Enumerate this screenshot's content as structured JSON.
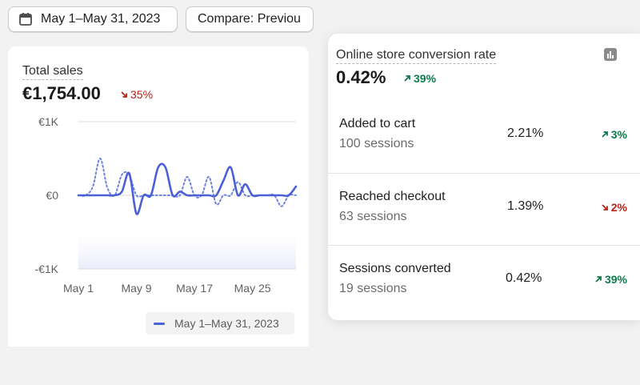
{
  "toolbar": {
    "date_range_label": "May 1–May 31, 2023",
    "compare_label": "Compare: Previou"
  },
  "total_sales": {
    "title": "Total sales",
    "value": "€1,754.00",
    "delta": "35%",
    "delta_direction": "down"
  },
  "chart_data": {
    "type": "line",
    "ylabel": "",
    "xlabel": "",
    "ylim": [
      -1000,
      1000
    ],
    "y_tick_labels": [
      "€1K",
      "€0",
      "-€1K"
    ],
    "y_ticks": [
      1000,
      0,
      -1000
    ],
    "x_range": [
      1,
      31
    ],
    "x_tick_labels": [
      "May 1",
      "May 9",
      "May 17",
      "May 25"
    ],
    "x_ticks": [
      1,
      9,
      17,
      25
    ],
    "grid": true,
    "legend": "bottom",
    "series": [
      {
        "name": "May 1–May 31, 2023",
        "style": "solid",
        "color": "#4b5fd6",
        "x": [
          1,
          2,
          3,
          4,
          5,
          6,
          7,
          8,
          9,
          10,
          11,
          12,
          13,
          14,
          15,
          16,
          17,
          18,
          19,
          20,
          21,
          22,
          23,
          24,
          25,
          26,
          27,
          28,
          29,
          30,
          31
        ],
        "values": [
          0,
          0,
          0,
          0,
          0,
          0,
          50,
          300,
          -250,
          0,
          0,
          380,
          380,
          0,
          50,
          0,
          0,
          0,
          0,
          0,
          200,
          380,
          0,
          150,
          0,
          0,
          0,
          0,
          0,
          0,
          120
        ]
      },
      {
        "name": "",
        "style": "dotted",
        "color": "#6b84dd",
        "x": [
          1,
          2,
          3,
          4,
          5,
          6,
          7,
          8,
          9,
          10,
          11,
          12,
          13,
          14,
          15,
          16,
          17,
          18,
          19,
          20,
          21,
          22,
          23,
          24,
          25,
          26,
          27,
          28,
          29,
          30,
          31
        ],
        "values": [
          0,
          0,
          120,
          500,
          100,
          0,
          280,
          280,
          0,
          0,
          0,
          0,
          0,
          0,
          0,
          250,
          0,
          0,
          250,
          -120,
          0,
          0,
          180,
          0,
          0,
          0,
          0,
          0,
          -150,
          0,
          0
        ]
      }
    ]
  },
  "conversion": {
    "title": "Online store conversion rate",
    "value": "0.42%",
    "delta": "39%",
    "delta_direction": "up",
    "chart_icon": "bar-chart-icon",
    "rows": [
      {
        "label": "Added to cart",
        "sessions": "100 sessions",
        "rate": "2.21%",
        "delta": "3%",
        "direction": "up"
      },
      {
        "label": "Reached checkout",
        "sessions": "63 sessions",
        "rate": "1.39%",
        "delta": "2%",
        "direction": "down"
      },
      {
        "label": "Sessions converted",
        "sessions": "19 sessions",
        "rate": "0.42%",
        "delta": "39%",
        "direction": "up"
      }
    ]
  },
  "colors": {
    "accent": "#4b5fd6",
    "positive": "#0a7a4b",
    "negative": "#b42318"
  }
}
